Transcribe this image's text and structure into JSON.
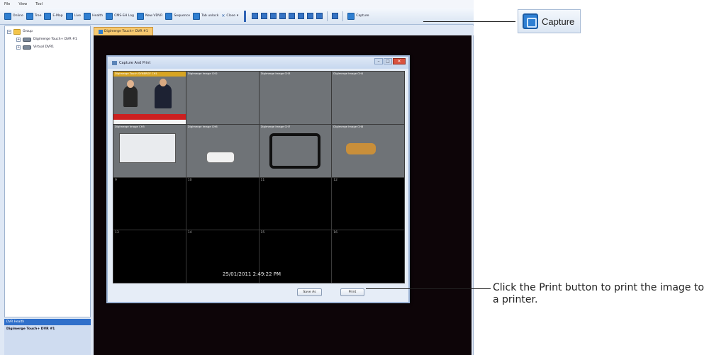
{
  "menu": [
    "File",
    "View",
    "Tool"
  ],
  "toolbar": {
    "buttons": [
      "Online",
      "Tree",
      "E-Map",
      "Live",
      "Health",
      "CMS-SH Log",
      "New VDVR",
      "Sequence",
      "Tab unlock"
    ],
    "close_label": "Close",
    "capture_label": "Capture"
  },
  "tree": {
    "root": "Group",
    "items": [
      "Digimerge Touch+ DVR #1",
      "Virtual DVR1"
    ]
  },
  "info": {
    "header": "DVR Health",
    "device": "Digimerge Touch+ DVR #1"
  },
  "tab": {
    "label": "Digimerge Touch+ DVR #1"
  },
  "dialog": {
    "title": "Capture And Print",
    "timestamp": "25/01/2011 2:49:22 PM",
    "save_as": "Save As",
    "print": "Print",
    "cells": [
      {
        "label": "Digimerge Touch SYNERGY CH1",
        "scene": "news"
      },
      {
        "label": "Digimerge Image CH2",
        "scene": "road"
      },
      {
        "label": "Digimerge Image CH3",
        "scene": "snow"
      },
      {
        "label": "Digimerge Image CH4",
        "scene": "drive"
      },
      {
        "label": "Digimerge Image CH5",
        "scene": "truck"
      },
      {
        "label": "Digimerge Image CH6",
        "scene": "lot"
      },
      {
        "label": "Digimerge Image CH7",
        "scene": "dark"
      },
      {
        "label": "Digimerge Image CH8",
        "scene": "yard"
      },
      {
        "number": "9"
      },
      {
        "number": "10"
      },
      {
        "number": "11"
      },
      {
        "number": "12"
      },
      {
        "number": "13"
      },
      {
        "number": "14"
      },
      {
        "number": "15"
      },
      {
        "number": "16"
      }
    ]
  },
  "callouts": {
    "capture": "Capture",
    "print_note": "Click the Print button to print the image to a printer."
  }
}
